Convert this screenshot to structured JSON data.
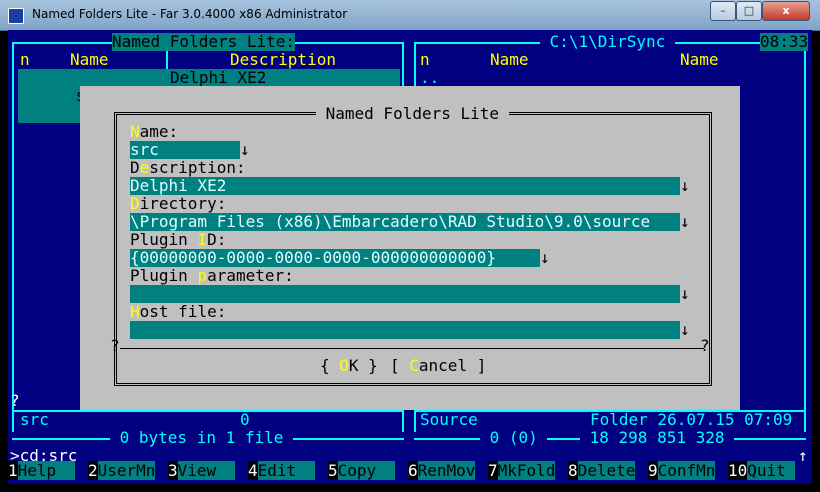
{
  "window": {
    "title": "Named Folders Lite - Far 3.0.4000 x86 Administrator",
    "controls": {
      "minimize": "–",
      "maximize": "□",
      "close": "x"
    }
  },
  "left_panel": {
    "title": "Named Folders Lite:",
    "col_n": "n",
    "col_name": "Name",
    "col_desc": "Description",
    "rows": [
      {
        "name": "src",
        "desc": "Delphi XE2"
      }
    ],
    "status_name": "src",
    "status_value": "0",
    "summary": " 0 bytes in 1 file ",
    "question": "?"
  },
  "right_panel": {
    "title": " C:\\1\\DirSync ",
    "clock": "08:33",
    "col_n": "n",
    "col_name": "Name",
    "col_name2": "Name",
    "updir": "..",
    "status_name": "Source",
    "status_info": "Folder 26.07.15 07:09",
    "summary": " 0 (0) ",
    "free": " 18 298 851 328 "
  },
  "dialog": {
    "title": " Named Folders Lite ",
    "name_label": "Name:",
    "name_value": "src",
    "desc_label": "Description:",
    "desc_value": "Delphi XE2",
    "dir_label": "Directory:",
    "dir_value": "\\Program Files (x86)\\Embarcadero\\RAD Studio\\9.0\\source",
    "plugin_id_label": "Plugin ID:",
    "plugin_id_value": "{00000000-0000-0000-0000-000000000000}",
    "plugin_param_label": "Plugin parameter:",
    "plugin_param_value": "",
    "host_label": "Host file:",
    "host_value": "",
    "ok_label": "{ OK }",
    "cancel_label": "[ Cancel ]",
    "history_arrow": "↓",
    "question": "?"
  },
  "command_line": ">cd:src",
  "command_arrow": "↑",
  "keybar": [
    {
      "num": "1",
      "label": "Help  "
    },
    {
      "num": "2",
      "label": "UserMn"
    },
    {
      "num": "3",
      "label": "View  "
    },
    {
      "num": "4",
      "label": "Edit  "
    },
    {
      "num": "5",
      "label": "Copy  "
    },
    {
      "num": "6",
      "label": "RenMov"
    },
    {
      "num": "7",
      "label": "MkFold"
    },
    {
      "num": "8",
      "label": "Delete"
    },
    {
      "num": "9",
      "label": "ConfMn"
    },
    {
      "num": "10",
      "label": "Quit "
    }
  ]
}
